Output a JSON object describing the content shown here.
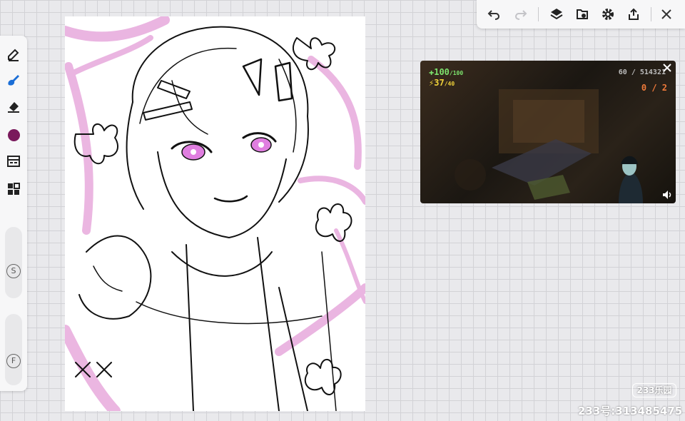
{
  "left_toolbar": {
    "tools": [
      {
        "name": "pen-tool-icon"
      },
      {
        "name": "brush-tool-icon"
      },
      {
        "name": "eraser-tool-icon"
      },
      {
        "name": "color-swatch"
      },
      {
        "name": "material-library-icon"
      },
      {
        "name": "grid-menu-icon"
      }
    ],
    "active_color": "#7a1a5c",
    "brush_accent": "#1b6ed6",
    "size_label": "S",
    "opacity_label": "F"
  },
  "top_toolbar": {
    "buttons": [
      "undo-icon",
      "redo-icon",
      "layers-icon",
      "import-file-icon",
      "settings-gear-icon",
      "share-export-icon",
      "close-icon"
    ]
  },
  "video_overlay": {
    "health": "100",
    "health_max": "/100",
    "armor": "37",
    "armor_max": "/40",
    "ammo": "60",
    "ammo_total": "514321",
    "kills": "0 / 2"
  },
  "watermark": {
    "logo": "233乐园",
    "id": "233号:313485475"
  }
}
